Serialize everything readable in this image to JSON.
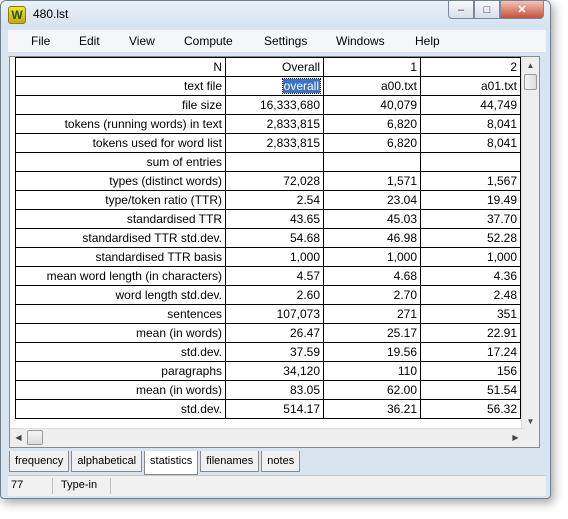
{
  "window": {
    "title": "480.lst",
    "app_icon_letter": "W"
  },
  "menu": [
    "File",
    "Edit",
    "View",
    "Compute",
    "Settings",
    "Windows",
    "Help"
  ],
  "table": {
    "columns": [
      "N",
      "Overall",
      "1",
      "2"
    ],
    "rows": [
      {
        "label": "text file",
        "values": [
          "overall",
          "a00.txt",
          "a01.txt"
        ]
      },
      {
        "label": "file size",
        "values": [
          "16,333,680",
          "40,079",
          "44,749"
        ]
      },
      {
        "label": "tokens (running words) in text",
        "values": [
          "2,833,815",
          "6,820",
          "8,041"
        ]
      },
      {
        "label": "tokens used for word list",
        "values": [
          "2,833,815",
          "6,820",
          "8,041"
        ]
      },
      {
        "label": "sum of entries",
        "values": [
          "",
          "",
          ""
        ]
      },
      {
        "label": "types (distinct words)",
        "values": [
          "72,028",
          "1,571",
          "1,567"
        ]
      },
      {
        "label": "type/token ratio (TTR)",
        "values": [
          "2.54",
          "23.04",
          "19.49"
        ]
      },
      {
        "label": "standardised TTR",
        "values": [
          "43.65",
          "45.03",
          "37.70"
        ]
      },
      {
        "label": "standardised TTR std.dev.",
        "values": [
          "54.68",
          "46.98",
          "52.28"
        ]
      },
      {
        "label": "standardised TTR basis",
        "values": [
          "1,000",
          "1,000",
          "1,000"
        ]
      },
      {
        "label": "mean word length (in characters)",
        "values": [
          "4.57",
          "4.68",
          "4.36"
        ]
      },
      {
        "label": "word length std.dev.",
        "values": [
          "2.60",
          "2.70",
          "2.48"
        ]
      },
      {
        "label": "sentences",
        "values": [
          "107,073",
          "271",
          "351"
        ]
      },
      {
        "label": "mean (in words)",
        "values": [
          "26.47",
          "25.17",
          "22.91"
        ]
      },
      {
        "label": "std.dev.",
        "values": [
          "37.59",
          "19.56",
          "17.24"
        ]
      },
      {
        "label": "paragraphs",
        "values": [
          "34,120",
          "110",
          "156"
        ]
      },
      {
        "label": "mean (in words)",
        "values": [
          "83.05",
          "62.00",
          "51.54"
        ]
      },
      {
        "label": "std.dev.",
        "values": [
          "514.17",
          "36.21",
          "56.32"
        ]
      }
    ],
    "selected_cell": "overall"
  },
  "tabs": [
    "frequency",
    "alphabetical",
    "statistics",
    "filenames",
    "notes"
  ],
  "active_tab": "statistics",
  "status": {
    "count": "77",
    "mode": "Type-in"
  }
}
